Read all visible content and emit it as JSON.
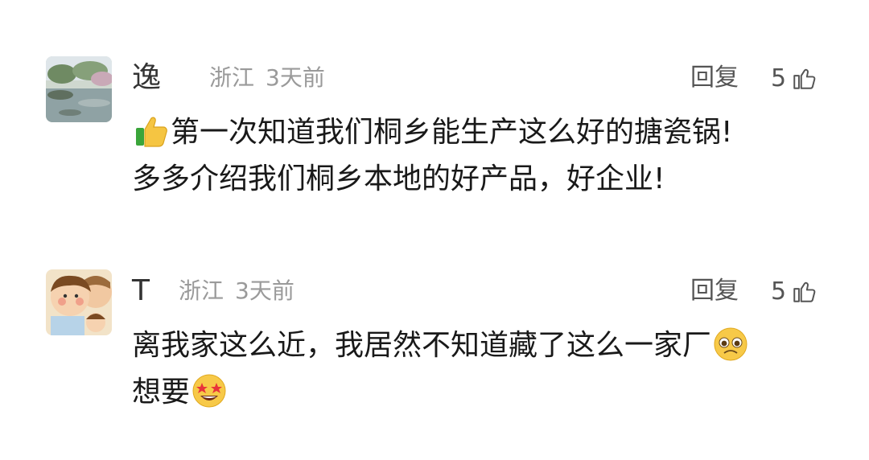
{
  "comments": [
    {
      "name": "逸",
      "location": "浙江",
      "time": "3天前",
      "reply_label": "回复",
      "likes": "5",
      "lines": [
        "第一次知道我们桐乡能生产这么好的搪瓷锅!",
        "多多介绍我们桐乡本地的好产品，好企业!"
      ],
      "emoji_start": "thumbs-up-emoji"
    },
    {
      "name": "T",
      "location": "浙江",
      "time": "3天前",
      "reply_label": "回复",
      "likes": "5",
      "lines": [
        "离我家这么近，我居然不知道藏了这么一家厂",
        "想要"
      ],
      "emoji_line1_end": "pleading-face-emoji",
      "emoji_line2_end": "star-struck-emoji"
    }
  ]
}
